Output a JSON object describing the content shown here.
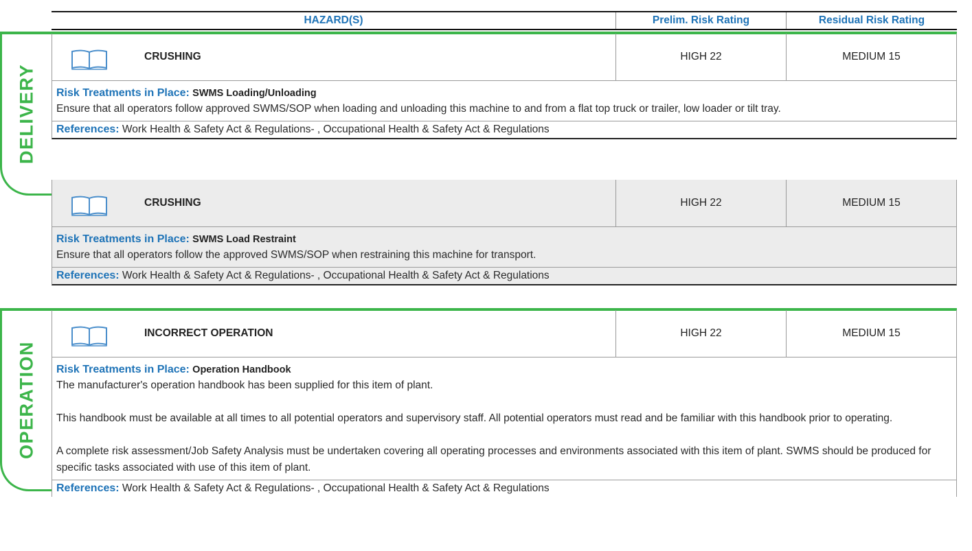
{
  "header": {
    "hazards": "HAZARD(S)",
    "prelim": "Prelim. Risk Rating",
    "residual": "Residual Risk Rating"
  },
  "sections": [
    {
      "label": "DELIVERY"
    },
    {
      "label": "OPERATION"
    }
  ],
  "labels": {
    "treatments": "Risk Treatments in Place:",
    "references": "References:"
  },
  "icon": "book-icon",
  "colors": {
    "accent_blue": "#1e73b7",
    "section_green": "#3cb54a",
    "shaded_row": "#ececec"
  },
  "hazards": [
    {
      "name": "CRUSHING",
      "prelim": "HIGH 22",
      "residual": "MEDIUM 15",
      "treatment_title": "SWMS Loading/Unloading",
      "paragraphs": [
        "Ensure that all operators follow approved SWMS/SOP when loading and unloading this machine to and from a flat top truck or trailer, low loader or tilt tray."
      ],
      "references": "Work Health & Safety Act & Regulations- , Occupational Health & Safety Act & Regulations"
    },
    {
      "name": "CRUSHING",
      "prelim": "HIGH 22",
      "residual": "MEDIUM 15",
      "treatment_title": "SWMS Load Restraint",
      "paragraphs": [
        "Ensure that all operators follow the approved SWMS/SOP when restraining this machine for transport."
      ],
      "references": "Work Health & Safety Act & Regulations- , Occupational Health & Safety Act & Regulations"
    },
    {
      "name": "INCORRECT OPERATION",
      "prelim": "HIGH 22",
      "residual": "MEDIUM 15",
      "treatment_title": "Operation Handbook",
      "paragraphs": [
        "The manufacturer's operation handbook has been supplied for this item of plant.",
        "This handbook must be available at all times to all potential operators and supervisory staff. All potential operators must read and be familiar with this handbook prior to operating.",
        "A complete risk assessment/Job Safety Analysis must be undertaken covering all operating processes and environments associated with this item of plant. SWMS should be produced for specific tasks associated with use of this item of plant."
      ],
      "references": "Work Health & Safety Act & Regulations- , Occupational Health & Safety Act & Regulations"
    }
  ]
}
